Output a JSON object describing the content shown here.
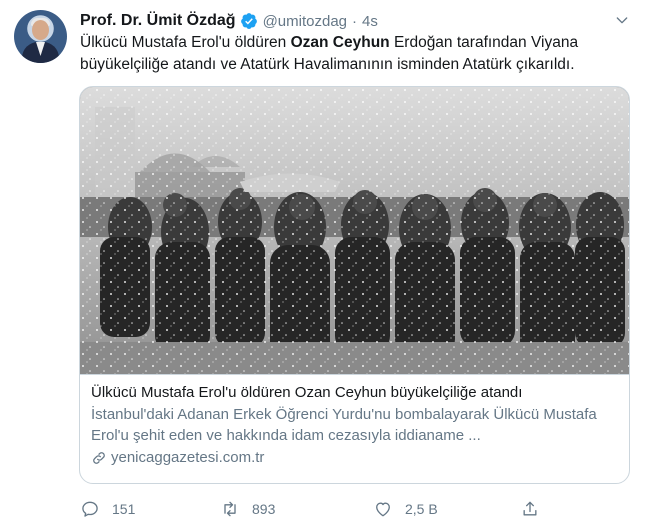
{
  "tweet": {
    "author_name": "Prof. Dr. Ümit Özdağ",
    "handle": "@umitozdag",
    "separator": "·",
    "time": "4s",
    "text_part1": "Ülkücü Mustafa Erol'u öldüren ",
    "text_bold": "Ozan Ceyhun",
    "text_part2": " Erdoğan tarafından Viyana büyükelçiliğe atandı ve Atatürk Havalimanının isminden Atatürk çıkarıldı."
  },
  "card": {
    "title": "Ülkücü Mustafa Erol'u öldüren Ozan Ceyhun büyükelçiliğe atandı",
    "description": "İstanbul'daki Adanan Erkek Öğrenci Yurdu'nu bombalayarak Ülkücü Mustafa Erol'u şehit eden ve hakkında idam cezasıyla iddianame ...",
    "domain": "yenicaggazetesi.com.tr",
    "image_icon": "black-and-white-photo-crowd-in-snow"
  },
  "actions": {
    "reply_count": "151",
    "retweet_count": "893",
    "like_count": "2,5 B",
    "share_icon": "share-icon"
  },
  "colors": {
    "text": "#14171a",
    "secondary": "#657786",
    "border": "#ccd6dd",
    "verified": "#1da1f2"
  }
}
